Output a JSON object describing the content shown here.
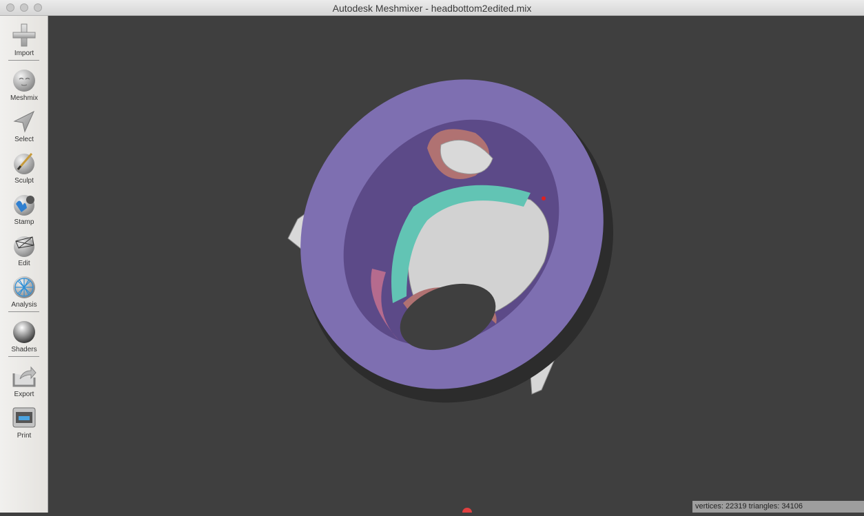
{
  "window": {
    "title": "Autodesk Meshmixer - headbottom2edited.mix"
  },
  "toolbar": {
    "items": [
      {
        "id": "import",
        "label": "Import",
        "icon": "plus-icon"
      },
      {
        "id": "meshmix",
        "label": "Meshmix",
        "icon": "bunny-sphere-icon"
      },
      {
        "id": "select",
        "label": "Select",
        "icon": "arrow-cursor-icon"
      },
      {
        "id": "sculpt",
        "label": "Sculpt",
        "icon": "brush-sphere-icon"
      },
      {
        "id": "stamp",
        "label": "Stamp",
        "icon": "stamp-sphere-icon"
      },
      {
        "id": "edit",
        "label": "Edit",
        "icon": "wireframe-sphere-icon"
      },
      {
        "id": "analysis",
        "label": "Analysis",
        "icon": "mesh-network-icon"
      },
      {
        "id": "shaders",
        "label": "Shaders",
        "icon": "chrome-sphere-icon"
      },
      {
        "id": "export",
        "label": "Export",
        "icon": "export-tray-icon"
      },
      {
        "id": "print",
        "label": "Print",
        "icon": "printer-icon"
      }
    ]
  },
  "viewport": {
    "background": "#3f3f3f",
    "model": {
      "rim_color": "#7e6fb1",
      "inner_color": "#5c4a88",
      "mesh_color": "#d4d4d4",
      "teal_color": "#62c4b4",
      "pink_color": "#b87070"
    }
  },
  "status": {
    "text": "vertices: 22319 triangles: 34106"
  }
}
